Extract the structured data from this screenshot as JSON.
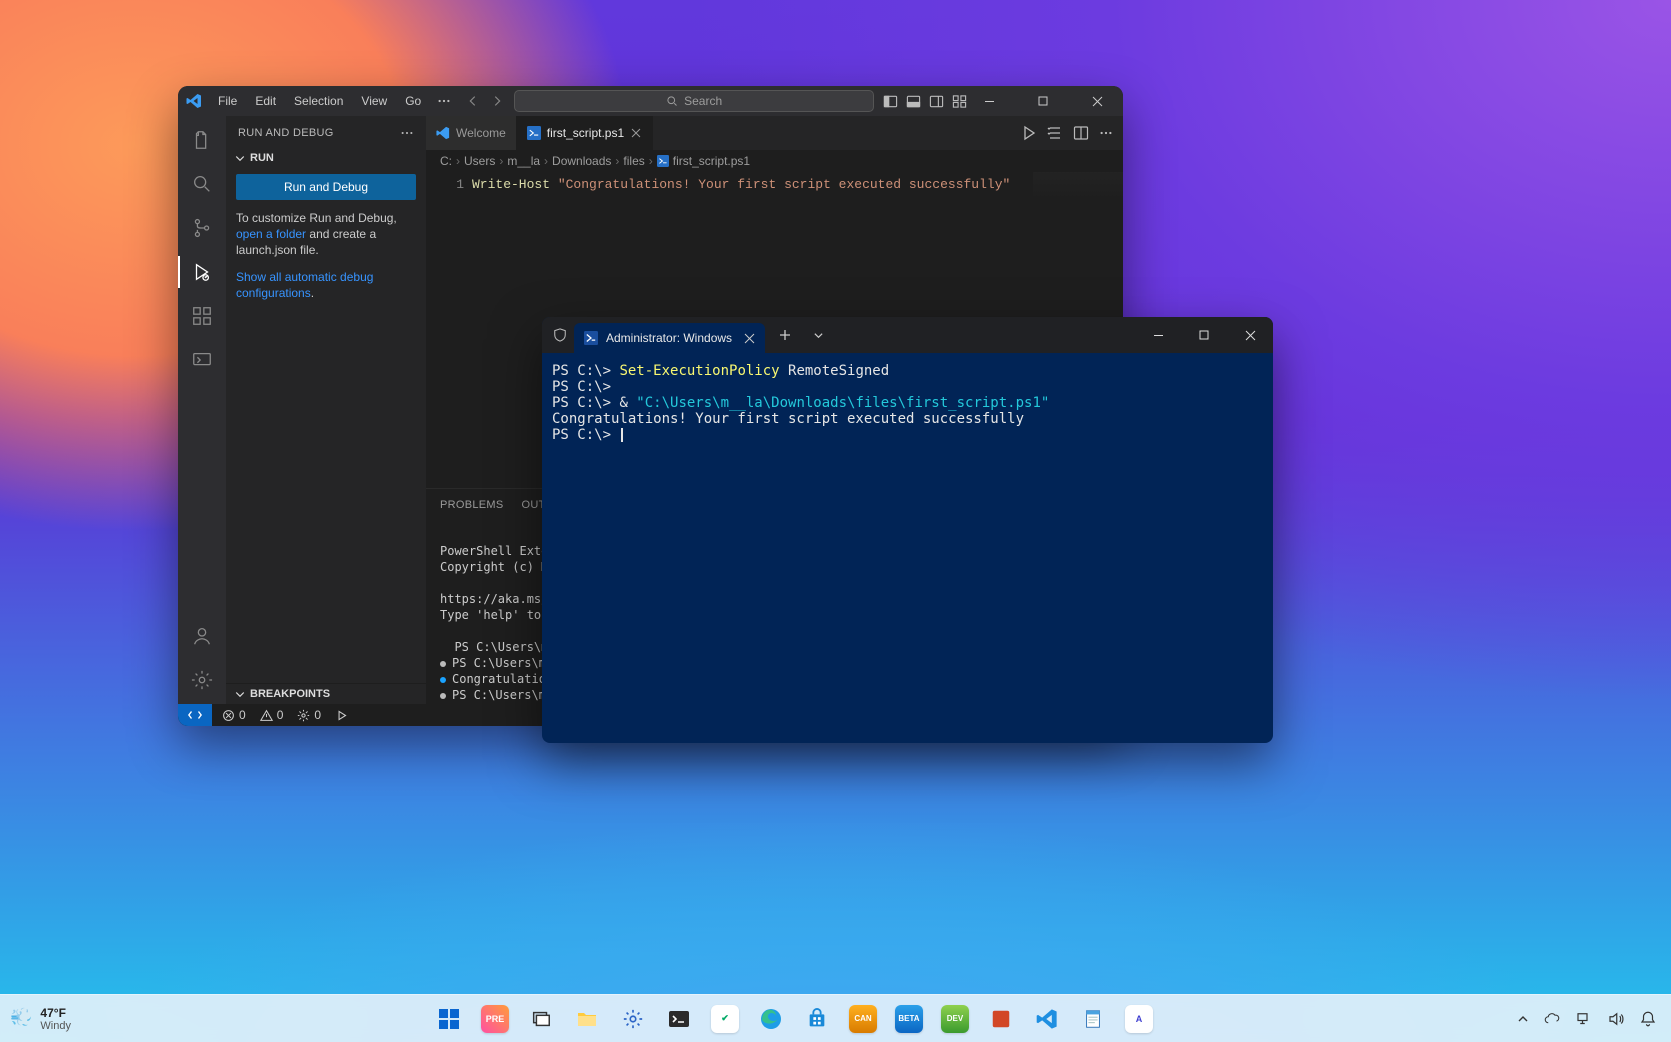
{
  "vscode": {
    "menus": [
      "File",
      "Edit",
      "Selection",
      "View",
      "Go"
    ],
    "searchPlaceholder": "Search",
    "sidebar": {
      "title": "RUN AND DEBUG",
      "sectionRun": "RUN",
      "runDebugButton": "Run and Debug",
      "helpTextPrefix": "To customize Run and Debug, ",
      "helpLink": "open a folder",
      "helpTextSuffix": " and create a launch.json file.",
      "showAllLink": "Show all automatic debug configurations",
      "showAllSuffix": ".",
      "breakpoints": "BREAKPOINTS"
    },
    "tabs": {
      "welcome": "Welcome",
      "file": "first_script.ps1"
    },
    "breadcrumb": [
      "C:",
      "Users",
      "m__la",
      "Downloads",
      "files",
      "first_script.ps1"
    ],
    "editor": {
      "lineNo": "1",
      "cmd": "Write-Host",
      "str": "\"Congratulations! Your first script executed successfully\""
    },
    "panel": {
      "tabs": [
        "PROBLEMS",
        "OUTPUT"
      ],
      "lines": {
        "l1": "PowerShell Extens",
        "l2": "Copyright (c) Mic",
        "l3": "https://aka.ms/vs",
        "l4": "Type 'help' to ge",
        "l5": "PS C:\\Users\\m__la",
        "l6": "PS C:\\Users\\m__la",
        "l7": "Congratulations!",
        "l8": "PS C:\\Users\\m__la"
      }
    },
    "status": {
      "errors": "0",
      "warnings": "0",
      "ports": "0"
    }
  },
  "terminal": {
    "tabTitle": "Administrator: Windows Powe",
    "lines": {
      "l1_prompt": "PS C:\\> ",
      "l1_cmd": "Set-ExecutionPolicy",
      "l1_arg": " RemoteSigned",
      "l2": "PS C:\\>",
      "l3_prompt": "PS C:\\> ",
      "l3_amp": "& ",
      "l3_path": "\"C:\\Users\\m__la\\Downloads\\files\\first_script.ps1\"",
      "l4": "Congratulations! Your first script executed successfully",
      "l5": "PS C:\\> "
    }
  },
  "taskbar": {
    "weatherTemp": "47°F",
    "weatherDesc": "Windy"
  }
}
